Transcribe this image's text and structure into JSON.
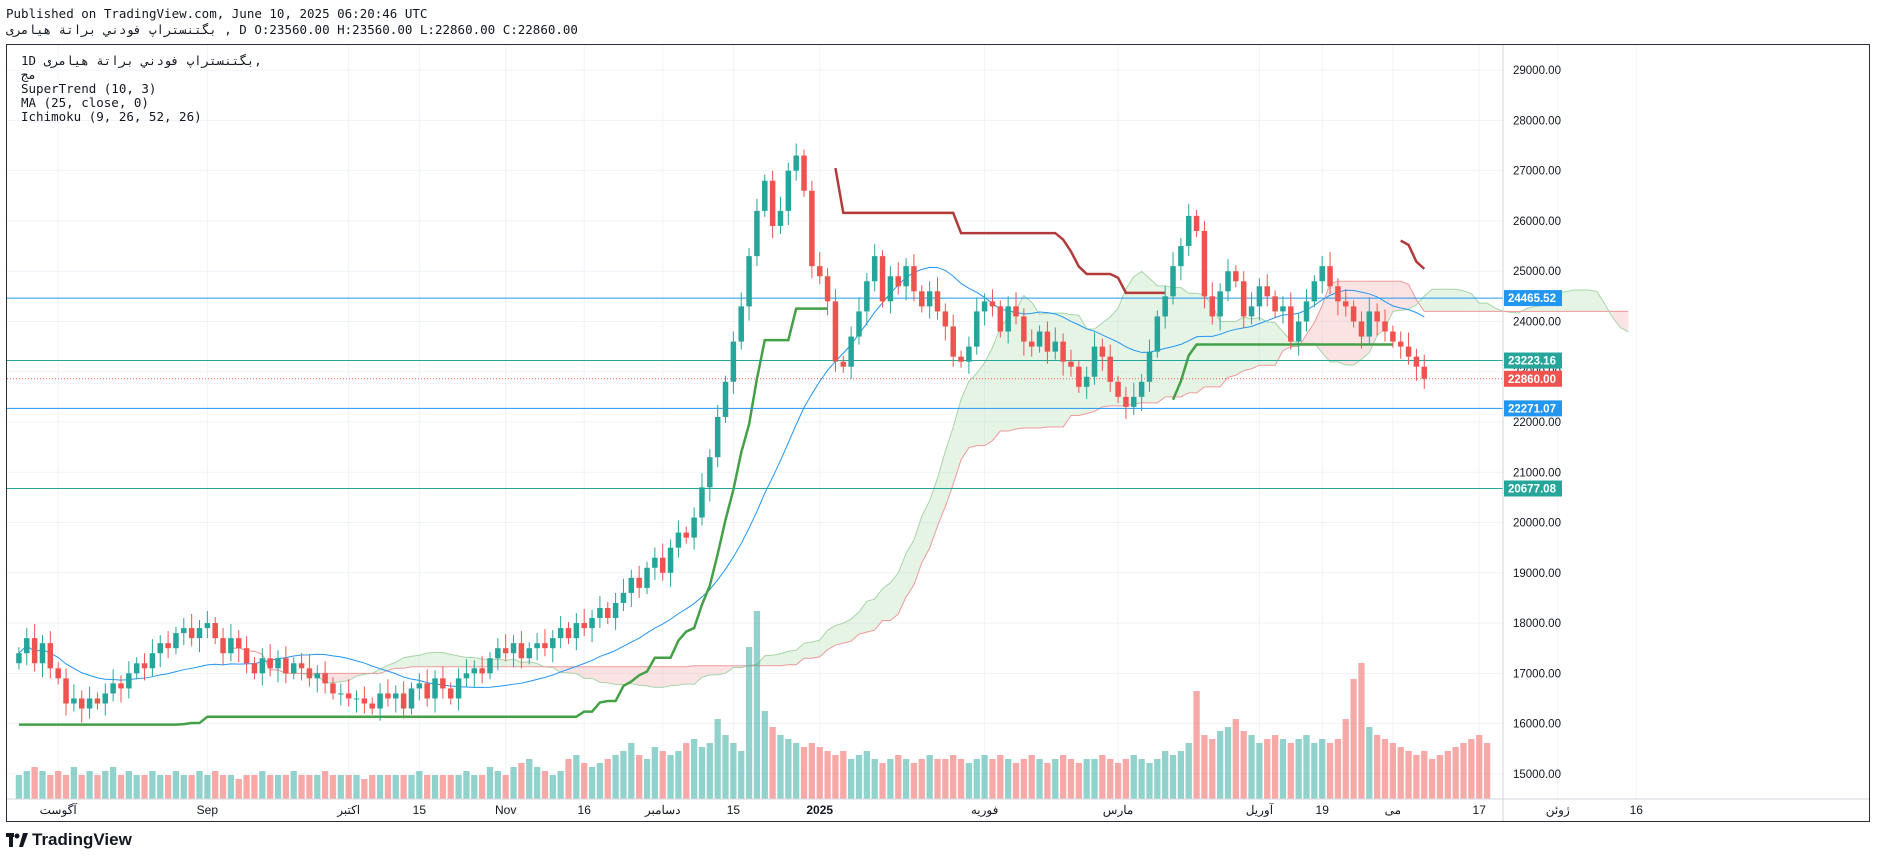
{
  "header": {
    "published": "Published on TradingView.com, June 10, 2025 06:20:46 UTC",
    "ohlc": "بگتنستراپ فودني براتة هيامرى , D O:23560.00 H:23560.00 L:22860.00 C:22860.00"
  },
  "legend": {
    "symbol": "1D بگتنستراپ فودني براتة هيامرى,",
    "line2": "مج",
    "supertrend": "SuperTrend (10, 3)",
    "ma": "MA (25, close, 0)",
    "ichimoku": "Ichimoku (9, 26, 52, 26)"
  },
  "footer": {
    "brand": "TradingView"
  },
  "colors": {
    "up": "#26a69a",
    "down": "#ef5350",
    "supertrend_up": "#43a047",
    "supertrend_down": "#b23a3a",
    "ma": "#2196f3",
    "cloud_bull": "#a5d6a7",
    "cloud_bear": "#ef9a9a",
    "hline": "#2196f3",
    "hline_teal": "#26a69a"
  },
  "chart_data": {
    "type": "candlestick",
    "ylim": [
      14500,
      29500
    ],
    "yticks": [
      15000,
      16000,
      17000,
      18000,
      19000,
      20000,
      21000,
      22000,
      23000,
      24000,
      25000,
      26000,
      27000,
      28000,
      29000
    ],
    "ytick_labels": [
      "15000.00",
      "16000.00",
      "17000.00",
      "18000.00",
      "19000.00",
      "20000.00",
      "21000.00",
      "22000.00",
      "23000.00",
      "24000.00",
      "25000.00",
      "26000.00",
      "27000.00",
      "28000.00",
      "29000.00"
    ],
    "xticks": [
      {
        "label": "آگوست",
        "bar": 5
      },
      {
        "label": "Sep",
        "bar": 24
      },
      {
        "label": "اکتبر",
        "bar": 42
      },
      {
        "label": "15",
        "bar": 51
      },
      {
        "label": "Nov",
        "bar": 62
      },
      {
        "label": "16",
        "bar": 72
      },
      {
        "label": "دسامبر",
        "bar": 82
      },
      {
        "label": "15",
        "bar": 91
      },
      {
        "label": "2025",
        "bar": 102
      },
      {
        "label": "فوریه",
        "bar": 123
      },
      {
        "label": "مارس",
        "bar": 140
      },
      {
        "label": "آوریل",
        "bar": 158
      },
      {
        "label": "19",
        "bar": 166
      },
      {
        "label": "می",
        "bar": 175
      },
      {
        "label": "17",
        "bar": 186
      },
      {
        "label": "ژوئن",
        "bar": 196
      },
      {
        "label": "16",
        "bar": 206
      }
    ],
    "horizontal_lines": [
      {
        "value": 24465.52,
        "label": "24465.52",
        "kind": "blue"
      },
      {
        "value": 23223.16,
        "label": "23223.16",
        "kind": "teal"
      },
      {
        "value": 22271.07,
        "label": "22271.07",
        "kind": "blue"
      },
      {
        "value": 20677.08,
        "label": "20677.08",
        "kind": "teal"
      },
      {
        "value": 22860.0,
        "label": "22860.00",
        "kind": "last"
      }
    ],
    "closes": [
      17400,
      17700,
      17200,
      17600,
      17100,
      16900,
      16400,
      16500,
      16300,
      16500,
      16400,
      16600,
      16800,
      16700,
      17000,
      17200,
      17100,
      17400,
      17600,
      17500,
      17800,
      17900,
      17700,
      17900,
      18000,
      17700,
      17400,
      17700,
      17500,
      17200,
      17000,
      17300,
      17100,
      17300,
      17000,
      17200,
      17100,
      16900,
      17000,
      16800,
      16600,
      16600,
      16500,
      16500,
      16400,
      16300,
      16600,
      16500,
      16600,
      16300,
      16700,
      16800,
      16500,
      16900,
      16700,
      16500,
      16900,
      17000,
      17100,
      17000,
      17300,
      17500,
      17400,
      17600,
      17300,
      17500,
      17600,
      17500,
      17700,
      17900,
      17700,
      18000,
      17900,
      18100,
      18300,
      18100,
      18400,
      18600,
      18900,
      18700,
      19100,
      19300,
      19000,
      19500,
      19800,
      19700,
      20100,
      20700,
      21300,
      22100,
      22800,
      23600,
      24300,
      25300,
      26200,
      26800,
      25900,
      26200,
      27000,
      27300,
      26600,
      25100,
      24900,
      24400,
      23200,
      23100,
      23700,
      24200,
      24800,
      25300,
      24400,
      24900,
      24700,
      25100,
      24600,
      24300,
      24600,
      24200,
      23900,
      23300,
      23200,
      23500,
      24200,
      24400,
      24300,
      23800,
      24300,
      24100,
      23600,
      23500,
      23800,
      23400,
      23600,
      23200,
      23100,
      22700,
      22900,
      23500,
      23300,
      22800,
      22500,
      22300,
      22500,
      22800,
      23400,
      24100,
      24500,
      25100,
      25500,
      26100,
      25800,
      24500,
      24100,
      24600,
      25000,
      24800,
      24100,
      24300,
      24700,
      24500,
      24200,
      24300,
      23600,
      24000,
      24400,
      24800,
      25100,
      24700,
      24400,
      24300,
      24000,
      23700,
      24200,
      24000,
      23800,
      23600,
      23500,
      23300,
      23100,
      22860
    ],
    "volume": [
      0.3,
      0.35,
      0.4,
      0.35,
      0.3,
      0.35,
      0.3,
      0.4,
      0.3,
      0.35,
      0.3,
      0.35,
      0.4,
      0.3,
      0.35,
      0.3,
      0.3,
      0.35,
      0.3,
      0.3,
      0.35,
      0.3,
      0.3,
      0.35,
      0.3,
      0.35,
      0.3,
      0.3,
      0.25,
      0.3,
      0.3,
      0.35,
      0.3,
      0.3,
      0.3,
      0.35,
      0.3,
      0.3,
      0.3,
      0.35,
      0.3,
      0.3,
      0.3,
      0.3,
      0.25,
      0.3,
      0.3,
      0.3,
      0.3,
      0.3,
      0.3,
      0.35,
      0.3,
      0.3,
      0.3,
      0.3,
      0.3,
      0.35,
      0.3,
      0.3,
      0.4,
      0.35,
      0.3,
      0.4,
      0.45,
      0.5,
      0.4,
      0.35,
      0.3,
      0.35,
      0.5,
      0.55,
      0.45,
      0.4,
      0.45,
      0.5,
      0.55,
      0.6,
      0.7,
      0.55,
      0.5,
      0.65,
      0.6,
      0.55,
      0.6,
      0.7,
      0.75,
      0.65,
      0.7,
      1.0,
      0.8,
      0.7,
      0.6,
      1.9,
      2.35,
      1.1,
      0.9,
      0.8,
      0.75,
      0.7,
      0.65,
      0.7,
      0.65,
      0.6,
      0.55,
      0.6,
      0.5,
      0.55,
      0.6,
      0.5,
      0.45,
      0.5,
      0.55,
      0.5,
      0.45,
      0.5,
      0.55,
      0.5,
      0.5,
      0.55,
      0.5,
      0.45,
      0.5,
      0.55,
      0.5,
      0.55,
      0.5,
      0.45,
      0.5,
      0.55,
      0.5,
      0.45,
      0.5,
      0.55,
      0.5,
      0.45,
      0.5,
      0.5,
      0.55,
      0.5,
      0.45,
      0.5,
      0.55,
      0.5,
      0.45,
      0.5,
      0.6,
      0.55,
      0.6,
      0.7,
      1.35,
      0.8,
      0.75,
      0.85,
      0.9,
      1.0,
      0.85,
      0.8,
      0.7,
      0.75,
      0.8,
      0.75,
      0.7,
      0.75,
      0.8,
      0.7,
      0.75,
      0.7,
      0.75,
      1.0,
      1.5,
      1.7,
      0.9,
      0.8,
      0.75,
      0.7,
      0.65,
      0.6,
      0.55,
      0.6,
      0.5,
      0.55,
      0.6,
      0.65,
      0.7,
      0.75,
      0.8,
      0.7
    ]
  }
}
